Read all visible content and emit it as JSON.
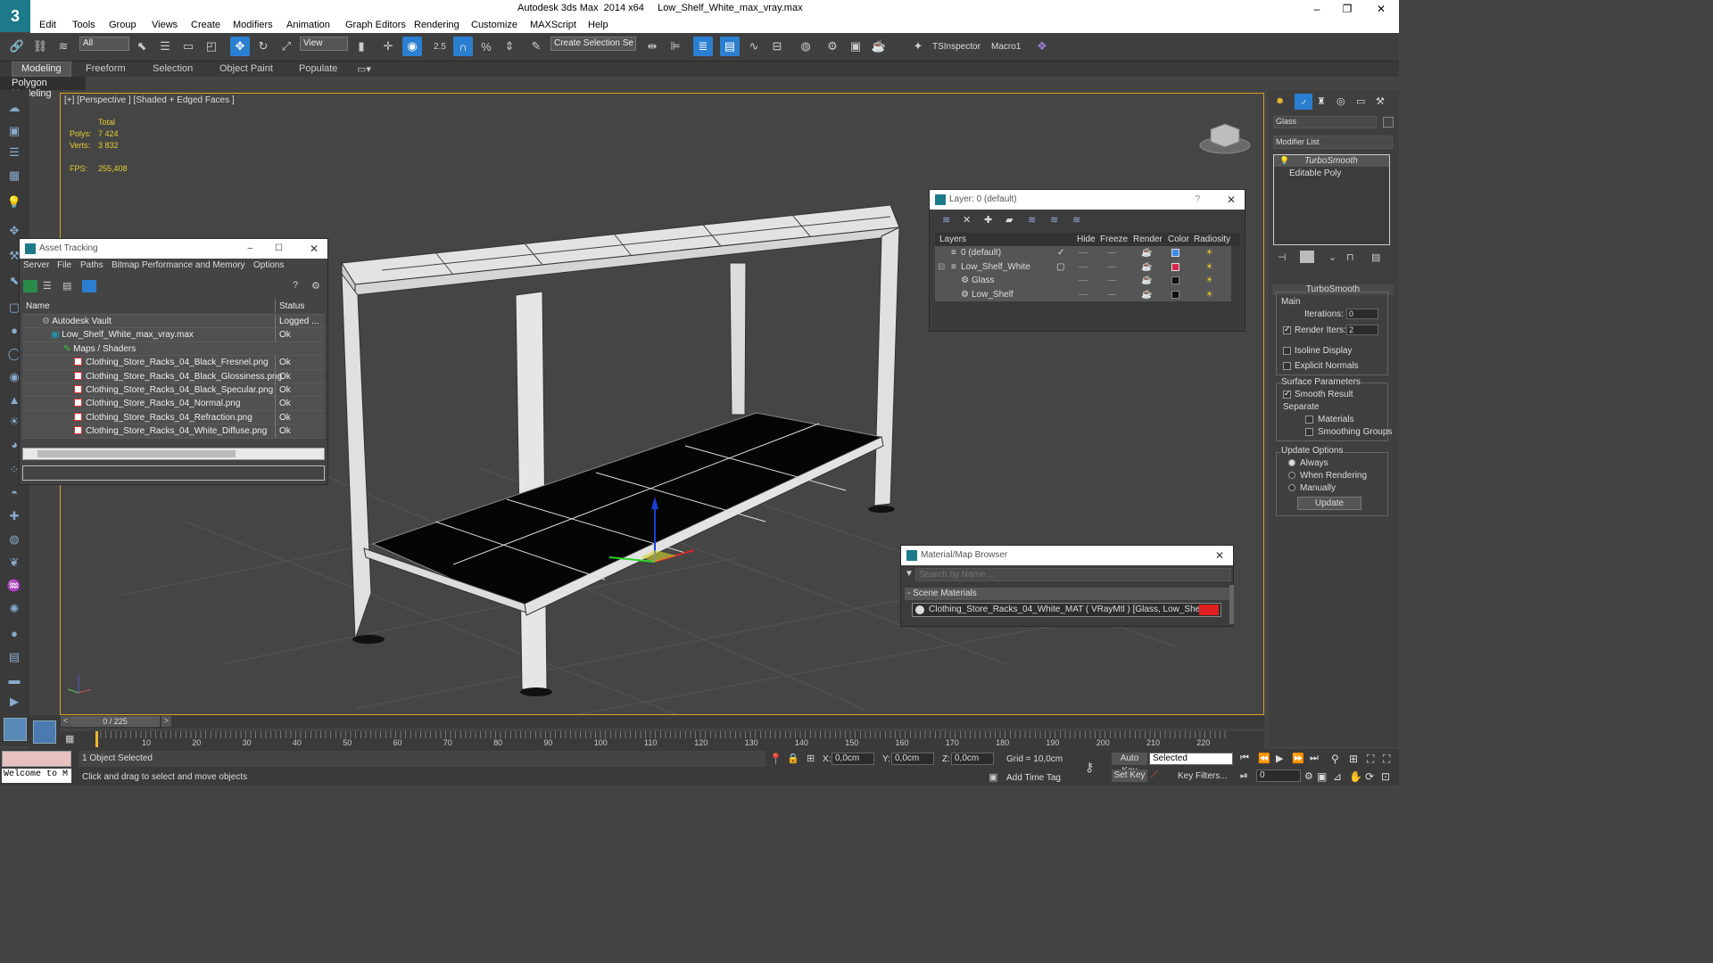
{
  "window": {
    "title": "Autodesk 3ds Max  2014 x64     Low_Shelf_White_max_vray.max",
    "logo": "3",
    "controls": [
      "–",
      "❐",
      "✕"
    ]
  },
  "menu": [
    "Edit",
    "Tools",
    "Group",
    "Views",
    "Create",
    "Modifiers",
    "Animation",
    "Graph Editors",
    "Rendering",
    "Customize",
    "MAXScript",
    "Help"
  ],
  "toolbar": {
    "selection_filter": "All",
    "ref_coord": "View",
    "named_selection": "Create Selection Se",
    "angle_snap": "2.5",
    "tsinspector": "TSInspector",
    "macro": "Macro1"
  },
  "ribbon": {
    "tabs": [
      "Modeling",
      "Freeform",
      "Selection",
      "Object Paint",
      "Populate"
    ],
    "active": "Modeling",
    "sub": "Polygon Modeling"
  },
  "viewport": {
    "label": "[+] [Perspective ] [Shaded + Edged Faces ]",
    "stats": {
      "total": "Total",
      "polys_label": "Polys:",
      "polys": "7 424",
      "verts_label": "Verts:",
      "verts": "3 832",
      "fps_label": "FPS:",
      "fps": "255,408"
    },
    "border_color": "#d6a227"
  },
  "asset_tracking": {
    "title": "Asset Tracking",
    "menu": [
      "Server",
      "File",
      "Paths",
      "Bitmap Performance and Memory",
      "Options"
    ],
    "columns": [
      "Name",
      "Status"
    ],
    "rows": [
      {
        "name": "Autodesk Vault",
        "status": "Logged ..."
      },
      {
        "name": "Low_Shelf_White_max_vray.max",
        "status": "Ok"
      },
      {
        "name": "Maps / Shaders",
        "status": ""
      },
      {
        "name": "Clothing_Store_Racks_04_Black_Fresnel.png",
        "status": "Ok"
      },
      {
        "name": "Clothing_Store_Racks_04_Black_Glossiness.png",
        "status": "Ok"
      },
      {
        "name": "Clothing_Store_Racks_04_Black_Specular.png",
        "status": "Ok"
      },
      {
        "name": "Clothing_Store_Racks_04_Normal.png",
        "status": "Ok"
      },
      {
        "name": "Clothing_Store_Racks_04_Refraction.png",
        "status": "Ok"
      },
      {
        "name": "Clothing_Store_Racks_04_White_Diffuse.png",
        "status": "Ok"
      }
    ]
  },
  "layer": {
    "title": "Layer: 0 (default)",
    "help": "?",
    "columns": [
      "Layers",
      "Hide",
      "Freeze",
      "Render",
      "Color",
      "Radiosity"
    ],
    "rows": [
      {
        "name": "0 (default)",
        "color": "#3a8ee6"
      },
      {
        "name": "Low_Shelf_White",
        "color": "#d6284a"
      },
      {
        "name": "Glass",
        "color": "#111111"
      },
      {
        "name": "Low_Shelf",
        "color": "#111111"
      }
    ]
  },
  "material_browser": {
    "title": "Material/Map Browser",
    "search_placeholder": "Search by Name ...",
    "section": "- Scene Materials",
    "item": "Clothing_Store_Racks_04_White_MAT  ( VRayMtl )  [Glass, Low_Shelf]",
    "swatch": "#e02020"
  },
  "command_panel": {
    "object_name": "Glass",
    "modifier_list": "Modifier List",
    "stack": [
      "TurboSmooth",
      "Editable Poly"
    ],
    "rollout": "TurboSmooth",
    "main": "Main",
    "iterations_label": "Iterations:",
    "iterations": "0",
    "render_iters_label": "Render Iters:",
    "render_iters": "2",
    "isoline": "Isoline Display",
    "explicit": "Explicit Normals",
    "surface": "Surface Parameters",
    "smooth": "Smooth Result",
    "separate": "Separate",
    "materials": "Materials",
    "smoothing": "Smoothing Groups",
    "update_options": "Update Options",
    "always": "Always",
    "when_rendering": "When Rendering",
    "manually": "Manually",
    "update": "Update"
  },
  "timeline": {
    "frame": "0 / 225",
    "ticks": [
      "10",
      "20",
      "30",
      "40",
      "50",
      "60",
      "70",
      "80",
      "90",
      "100",
      "110",
      "120",
      "130",
      "140",
      "150",
      "160",
      "170",
      "180",
      "190",
      "200",
      "210",
      "220"
    ]
  },
  "status": {
    "welcome": "Welcome to M",
    "selected": "1 Object Selected",
    "prompt": "Click and drag to select and move objects",
    "x_label": "X:",
    "x": "0,0cm",
    "y_label": "Y:",
    "y": "0,0cm",
    "z_label": "Z:",
    "z": "0,0cm",
    "grid": "Grid = 10,0cm",
    "add_time_tag": "Add Time Tag",
    "auto_key": "Auto Key",
    "set_key": "Set Key",
    "key_mode": "Selected",
    "key_filters": "Key Filters...",
    "frame_field": "0"
  }
}
